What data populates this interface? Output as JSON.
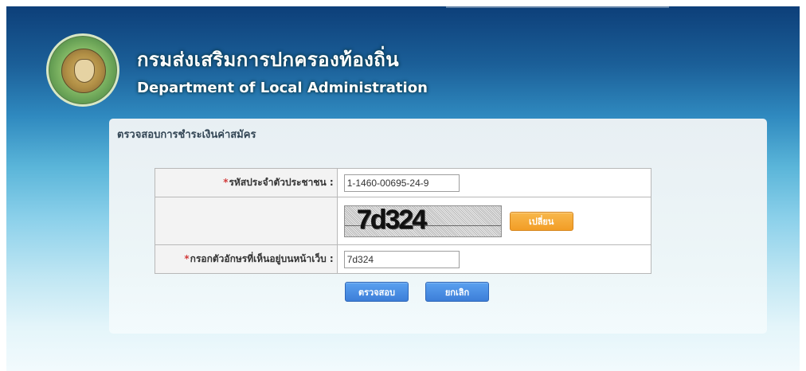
{
  "header": {
    "title_th": "กรมส่งเสริมการปกครองท้องถิ่น",
    "title_en": "Department of Local Administration",
    "logo_icon": "department-seal-icon"
  },
  "panel": {
    "title": "ตรวจสอบการชำระเงินค่าสมัคร"
  },
  "form": {
    "id_label": "รหัสประจำตัวประชาชน :",
    "id_value": "1-1460-00695-24-9",
    "captcha_code": "7d324",
    "captcha_change_button": "เปลี่ยน",
    "captcha_label": "กรอกตัวอักษรที่เห็นอยู่บนหน้าเว็บ :",
    "captcha_value": "7d324"
  },
  "actions": {
    "check_button": "ตรวจสอบ",
    "cancel_button": "ยกเลิก"
  },
  "colors": {
    "header_dark": "#0d3f79",
    "header_mid": "#2f89bf",
    "panel_bg": "#edf6f8",
    "orange_button": "#f29d26",
    "blue_button": "#3d7ed8",
    "required_mark": "#d23b3b"
  }
}
